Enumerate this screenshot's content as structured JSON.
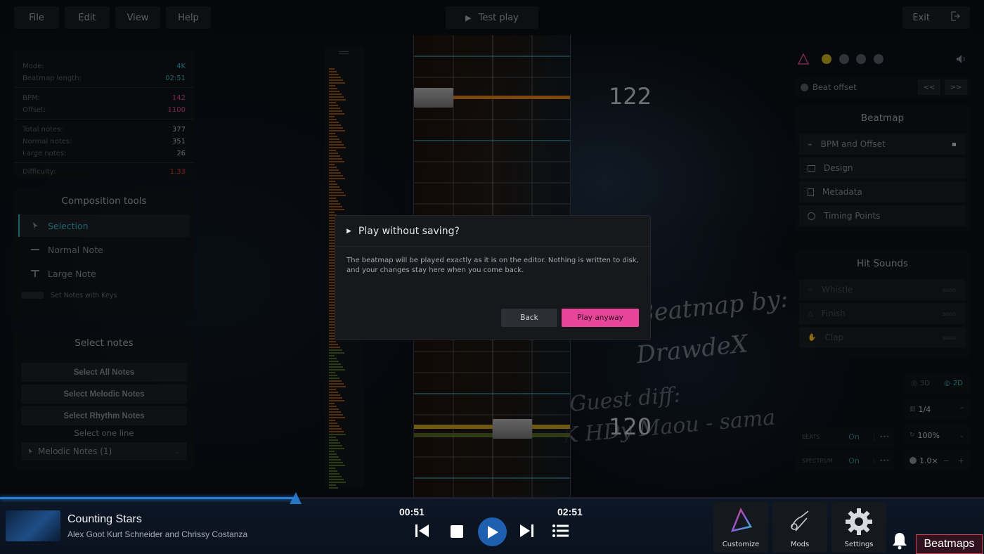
{
  "menu": {
    "file": "File",
    "edit": "Edit",
    "view": "View",
    "help": "Help",
    "test_play": "Test play",
    "exit": "Exit"
  },
  "info": {
    "mode_label": "Mode:",
    "mode": "4K",
    "length_label": "Beatmap length:",
    "length": "02:51",
    "bpm_label": "BPM:",
    "bpm": "142",
    "offset_label": "Offset:",
    "offset": "1100",
    "total_label": "Total notes:",
    "total": "377",
    "normal_label": "Normal notes:",
    "normal": "351",
    "large_label": "Large notes:",
    "large": "26",
    "difficulty_label": "Difficulty:",
    "difficulty": "1.33"
  },
  "composition": {
    "title": "Composition tools",
    "selection": "Selection",
    "normal_note": "Normal Note",
    "large_note": "Large Note",
    "set_notes_keys": "Set Notes with Keys"
  },
  "select_notes": {
    "title": "Select notes",
    "all": "Select All Notes",
    "melodic": "Select Melodic Notes",
    "rhythm": "Select Rhythm Notes",
    "one_line": "Select one line",
    "dropdown": "Melodic Notes (1)"
  },
  "field": {
    "beat_top": "122",
    "beat_bottom": "120"
  },
  "background_text": {
    "line1": "Beatmap by:",
    "line2": "DrawdeX",
    "line3": "Guest diff:",
    "line4": "K HDy Maou - sama"
  },
  "right": {
    "beat_offset": "Beat offset",
    "prev": "<<",
    "next": ">>",
    "beatmap_title": "Beatmap",
    "bpm_offset": "BPM and Offset",
    "design": "Design",
    "metadata": "Metadata",
    "timing_points": "Timing Points",
    "hit_sounds_title": "Hit Sounds",
    "whistle": "Whistle",
    "finish": "Finish",
    "clap": "Clap",
    "soon": "soon",
    "view_3d": "3D",
    "view_2d": "2D",
    "snap": "1/4",
    "speed": "100%",
    "zoom": "1.0×",
    "beats_label": "BEATS",
    "beats_value": "On",
    "spectrum_label": "SPECTRUM",
    "spectrum_value": "On",
    "more": "•••",
    "minus": "−",
    "plus": "+"
  },
  "dialog": {
    "title": "Play without saving?",
    "body_line1": "The beatmap will be played exactly as it is on the editor. Nothing is written to disk,",
    "body_line2": "and your changes stay here when you come back.",
    "back": "Back",
    "play_anyway": "Play anyway"
  },
  "player": {
    "song_title": "Counting Stars",
    "artist": "Alex Goot Kurt Schneider and Chrissy Costanza",
    "current_time": "00:51",
    "total_time": "02:51",
    "progress": 0.3
  },
  "bottom_buttons": {
    "customize": "Customize",
    "mods": "Mods",
    "settings": "Settings",
    "beatmaps": "Beatmaps"
  },
  "colors": {
    "accent_pink": "#e8459a",
    "accent_cyan": "#33b9c9",
    "accent_blue": "#2a7fd4"
  }
}
